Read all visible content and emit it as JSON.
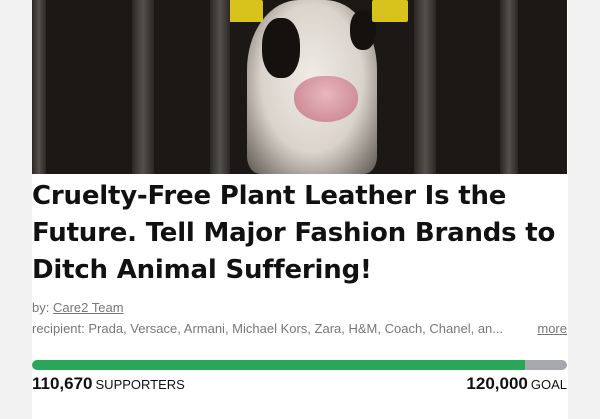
{
  "petition": {
    "title": "Cruelty-Free Plant Leather Is the Future. Tell Major Fashion Brands to Ditch Animal Suffering!",
    "by_label": "by:",
    "author": "Care2 Team",
    "recipient_label": "recipient:",
    "recipients": "Prada, Versace, Armani, Michael Kors, Zara, H&M, Coach, Chanel, an...",
    "more_label": "more"
  },
  "progress": {
    "supporters": "110,670",
    "supporters_label": "SUPPORTERS",
    "goal": "120,000",
    "goal_label": "GOAL",
    "fraction": 0.922
  },
  "colors": {
    "progress_fill": "#2aa55a",
    "progress_track": "#a7a7ae"
  },
  "hero_image": "calf-behind-bars-photo"
}
